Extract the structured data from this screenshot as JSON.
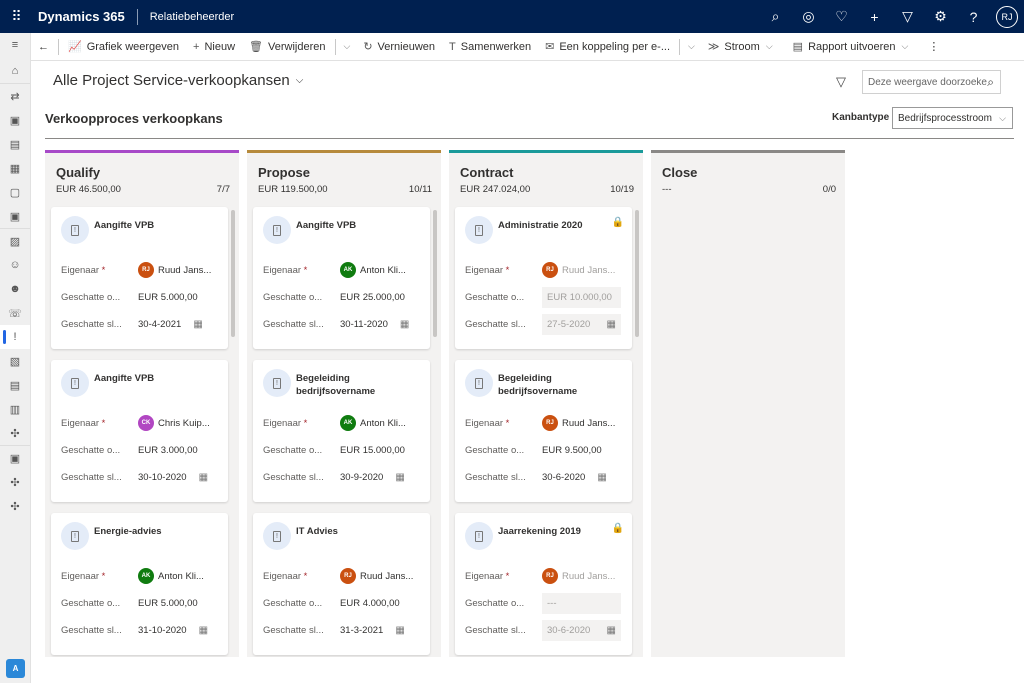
{
  "topbar": {
    "brand": "Dynamics 365",
    "app": "Relatiebeheerder",
    "user_initials": "RJ",
    "icons": [
      "search-icon",
      "assistant-icon",
      "lightbulb-icon",
      "plus-icon",
      "filter-icon",
      "gear-icon",
      "help-icon"
    ]
  },
  "sidebar": {
    "items": [
      "menu-icon",
      "home-icon",
      "recent-icon",
      "clipboard-icon",
      "briefcase-icon",
      "report-icon",
      "document-icon",
      "case-icon",
      "folder-icon",
      "contacts-icon",
      "person-icon",
      "phone-icon",
      "opportunity-icon",
      "quote-icon",
      "invoice-icon",
      "table-icon",
      "puzzle-icon",
      "case-icon",
      "puzzle-icon",
      "puzzle-icon"
    ],
    "selected": 12,
    "area_initial": "A"
  },
  "commandbar": {
    "back": "←",
    "items": [
      {
        "label": "Grafiek weergeven",
        "icon": "chart-icon",
        "glyph": "📈"
      },
      {
        "label": "Nieuw",
        "icon": "plus-icon",
        "glyph": "+"
      },
      {
        "label": "Verwijderen",
        "icon": "trash-icon",
        "glyph": "🗑"
      },
      {
        "label": "Vernieuwen",
        "icon": "refresh-icon",
        "glyph": "↻"
      },
      {
        "label": "Samenwerken",
        "icon": "teams-icon",
        "glyph": "T"
      },
      {
        "label": "Een koppeling per e-...",
        "icon": "email-link-icon",
        "glyph": "✉"
      },
      {
        "label": "Stroom",
        "icon": "flow-icon",
        "glyph": "≫"
      },
      {
        "label": "Rapport uitvoeren",
        "icon": "report-icon",
        "glyph": "▤"
      }
    ]
  },
  "view": {
    "title": "Alle Project Service-verkoopkansen",
    "search_placeholder": "Deze weergave doorzoeke",
    "subtitle": "Verkoopproces verkoopkans",
    "kanban_label": "Kanbantype",
    "kanban_value": "Bedrijfsprocesstroom"
  },
  "labels": {
    "owner": "Eigenaar",
    "required": "*",
    "revenue": "Geschatte o...",
    "close": "Geschatte sl..."
  },
  "colors": {
    "qualify": "#a74ac8",
    "propose": "#b68a3c",
    "contract": "#1a9a9a",
    "close": "#8a8886"
  },
  "columns": [
    {
      "name": "Qualify",
      "sum": "EUR 46.500,00",
      "count": "7/7",
      "color": "#a74ac8",
      "cards": [
        {
          "title": "Aangifte VPB",
          "owner": "Ruud Jans...",
          "initials": "RJ",
          "avcolor": "#ca5010",
          "revenue": "EUR 5.000,00",
          "close": "30-4-2021",
          "locked": false
        },
        {
          "title": "Aangifte VPB",
          "owner": "Chris Kuip...",
          "initials": "CK",
          "avcolor": "#b146c2",
          "revenue": "EUR 3.000,00",
          "close": "30-10-2020",
          "locked": false
        },
        {
          "title": "Energie-advies",
          "owner": "Anton Kli...",
          "initials": "AK",
          "avcolor": "#107c10",
          "revenue": "EUR 5.000,00",
          "close": "31-10-2020",
          "locked": false
        }
      ]
    },
    {
      "name": "Propose",
      "sum": "EUR 119.500,00",
      "count": "10/11",
      "color": "#b68a3c",
      "cards": [
        {
          "title": "Aangifte VPB",
          "owner": "Anton Kli...",
          "initials": "AK",
          "avcolor": "#107c10",
          "revenue": "EUR 25.000,00",
          "close": "30-11-2020",
          "locked": false
        },
        {
          "title": "Begeleiding bedrijfsovername",
          "owner": "Anton Kli...",
          "initials": "AK",
          "avcolor": "#107c10",
          "revenue": "EUR 15.000,00",
          "close": "30-9-2020",
          "locked": false
        },
        {
          "title": "IT Advies",
          "owner": "Ruud Jans...",
          "initials": "RJ",
          "avcolor": "#ca5010",
          "revenue": "EUR 4.000,00",
          "close": "31-3-2021",
          "locked": false
        }
      ]
    },
    {
      "name": "Contract",
      "sum": "EUR 247.024,00",
      "count": "10/19",
      "color": "#1a9a9a",
      "cards": [
        {
          "title": "Administratie 2020",
          "owner": "Ruud Jans...",
          "initials": "RJ",
          "avcolor": "#ca5010",
          "revenue": "EUR 10.000,00",
          "close": "27-5-2020",
          "locked": true
        },
        {
          "title": "Begeleiding bedrijfsovername",
          "owner": "Ruud Jans...",
          "initials": "RJ",
          "avcolor": "#ca5010",
          "revenue": "EUR 9.500,00",
          "close": "30-6-2020",
          "locked": false
        },
        {
          "title": "Jaarrekening 2019",
          "owner": "Ruud Jans...",
          "initials": "RJ",
          "avcolor": "#ca5010",
          "revenue": "---",
          "close": "30-6-2020",
          "locked": true
        }
      ]
    },
    {
      "name": "Close",
      "sum": "---",
      "count": "0/0",
      "color": "#8a8886",
      "cards": []
    }
  ]
}
